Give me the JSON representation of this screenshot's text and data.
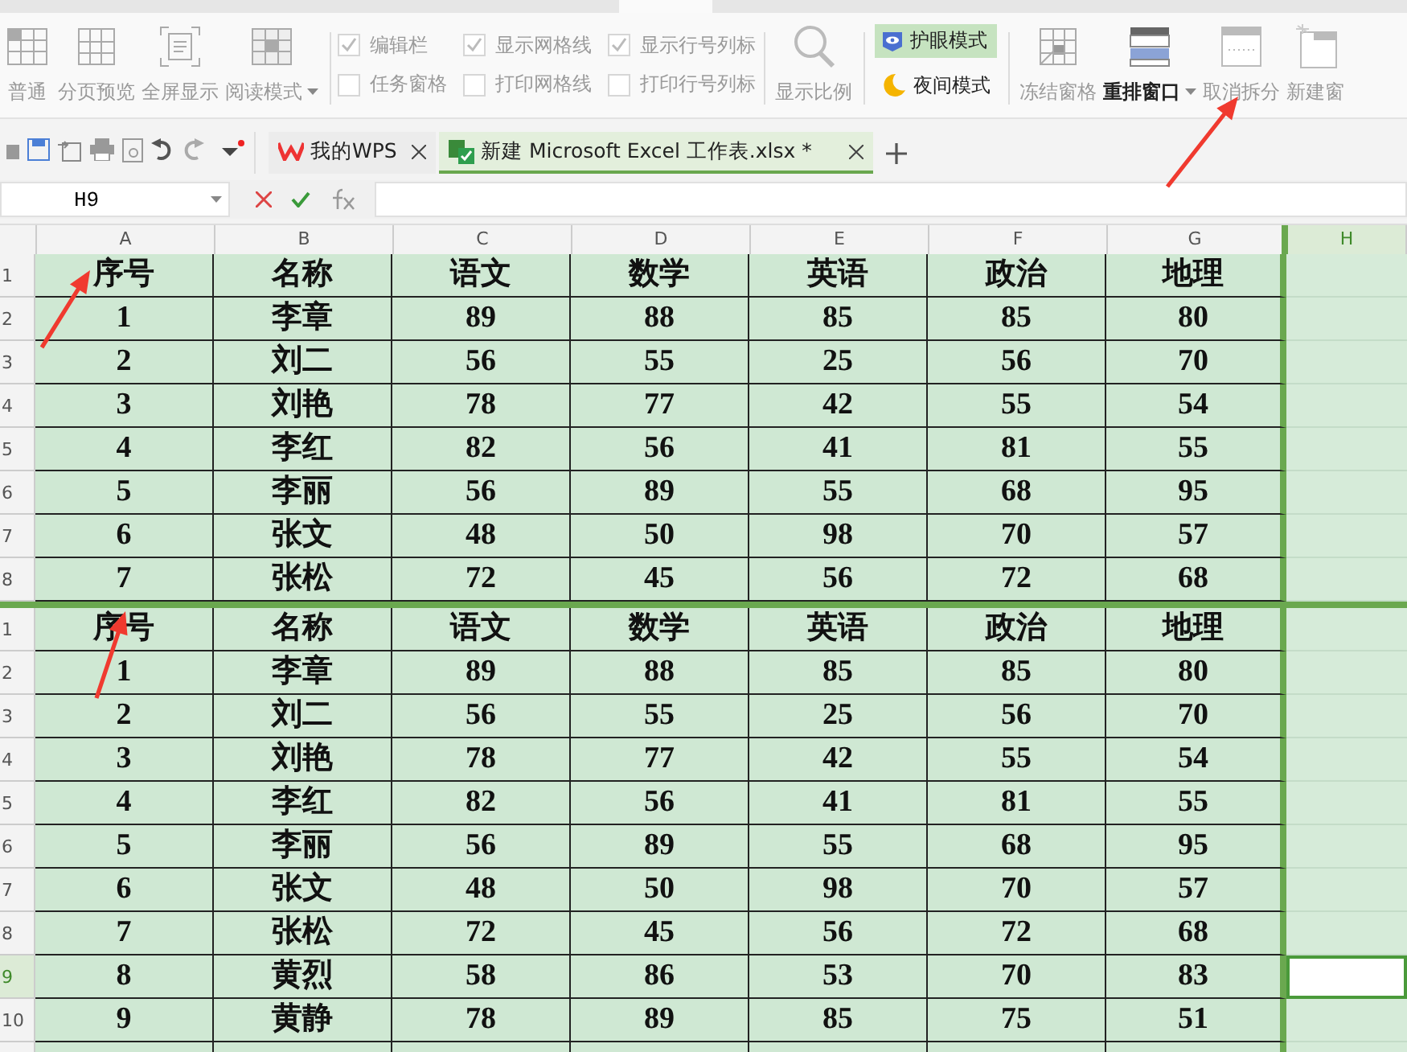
{
  "ribbon": {
    "view_buttons": [
      {
        "kind": "normal",
        "label": "普通",
        "disabled": true,
        "dropdown": false
      },
      {
        "kind": "page-preview",
        "label": "分页预览",
        "disabled": true,
        "dropdown": false
      },
      {
        "kind": "fullscreen",
        "label": "全屏显示",
        "disabled": true,
        "dropdown": false
      },
      {
        "kind": "reading",
        "label": "阅读模式",
        "disabled": true,
        "dropdown": true
      }
    ],
    "checkboxes": [
      {
        "label": "编辑栏",
        "checked": true
      },
      {
        "label": "任务窗格",
        "checked": false
      },
      {
        "label": "显示网格线",
        "checked": true
      },
      {
        "label": "打印网格线",
        "checked": false
      },
      {
        "label": "显示行号列标",
        "checked": true
      },
      {
        "label": "打印行号列标",
        "checked": false
      }
    ],
    "zoom_button": {
      "label": "显示比例",
      "disabled": true
    },
    "modes": [
      {
        "kind": "eye",
        "label": "护眼模式",
        "selected": true
      },
      {
        "kind": "night",
        "label": "夜间模式",
        "selected": false
      }
    ],
    "window_buttons": [
      {
        "kind": "freeze",
        "label": "冻结窗格",
        "disabled": true,
        "dropdown": false
      },
      {
        "kind": "arrange",
        "label": "重排窗口",
        "disabled": false,
        "dropdown": true
      },
      {
        "kind": "unsplit",
        "label": "取消拆分",
        "disabled": true,
        "dropdown": false
      },
      {
        "kind": "new-window",
        "label": "新建窗",
        "disabled": true,
        "dropdown": false
      }
    ]
  },
  "doc_tabs": [
    {
      "kind": "wps",
      "label": "我的WPS",
      "selected": false
    },
    {
      "kind": "excel",
      "label": "新建 Microsoft Excel 工作表.xlsx *",
      "selected": true
    }
  ],
  "formula_bar": {
    "name_box": "H9"
  },
  "columns": [
    {
      "label": "A",
      "selected": false
    },
    {
      "label": "B",
      "selected": false
    },
    {
      "label": "C",
      "selected": false
    },
    {
      "label": "D",
      "selected": false
    },
    {
      "label": "E",
      "selected": false
    },
    {
      "label": "F",
      "selected": false
    },
    {
      "label": "G",
      "selected": false
    },
    {
      "label": "H",
      "selected": true
    }
  ],
  "panes": [
    {
      "rows": [
        {
          "num": "1",
          "selected": false,
          "cells": [
            "序号",
            "名称",
            "语文",
            "数学",
            "英语",
            "政治",
            "地理"
          ]
        },
        {
          "num": "2",
          "selected": false,
          "cells": [
            "1",
            "李章",
            "89",
            "88",
            "85",
            "85",
            "80"
          ]
        },
        {
          "num": "3",
          "selected": false,
          "cells": [
            "2",
            "刘二",
            "56",
            "55",
            "25",
            "56",
            "70"
          ]
        },
        {
          "num": "4",
          "selected": false,
          "cells": [
            "3",
            "刘艳",
            "78",
            "77",
            "42",
            "55",
            "54"
          ]
        },
        {
          "num": "5",
          "selected": false,
          "cells": [
            "4",
            "李红",
            "82",
            "56",
            "41",
            "81",
            "55"
          ]
        },
        {
          "num": "6",
          "selected": false,
          "cells": [
            "5",
            "李丽",
            "56",
            "89",
            "55",
            "68",
            "95"
          ]
        },
        {
          "num": "7",
          "selected": false,
          "cells": [
            "6",
            "张文",
            "48",
            "50",
            "98",
            "70",
            "57"
          ]
        },
        {
          "num": "8",
          "selected": false,
          "cells": [
            "7",
            "张松",
            "72",
            "45",
            "56",
            "72",
            "68"
          ]
        }
      ]
    },
    {
      "rows": [
        {
          "num": "1",
          "selected": false,
          "cells": [
            "序号",
            "名称",
            "语文",
            "数学",
            "英语",
            "政治",
            "地理"
          ]
        },
        {
          "num": "2",
          "selected": false,
          "cells": [
            "1",
            "李章",
            "89",
            "88",
            "85",
            "85",
            "80"
          ]
        },
        {
          "num": "3",
          "selected": false,
          "cells": [
            "2",
            "刘二",
            "56",
            "55",
            "25",
            "56",
            "70"
          ]
        },
        {
          "num": "4",
          "selected": false,
          "cells": [
            "3",
            "刘艳",
            "78",
            "77",
            "42",
            "55",
            "54"
          ]
        },
        {
          "num": "5",
          "selected": false,
          "cells": [
            "4",
            "李红",
            "82",
            "56",
            "41",
            "81",
            "55"
          ]
        },
        {
          "num": "6",
          "selected": false,
          "cells": [
            "5",
            "李丽",
            "56",
            "89",
            "55",
            "68",
            "95"
          ]
        },
        {
          "num": "7",
          "selected": false,
          "cells": [
            "6",
            "张文",
            "48",
            "50",
            "98",
            "70",
            "57"
          ]
        },
        {
          "num": "8",
          "selected": false,
          "cells": [
            "7",
            "张松",
            "72",
            "45",
            "56",
            "72",
            "68"
          ]
        },
        {
          "num": "9",
          "selected": true,
          "cells": [
            "8",
            "黄烈",
            "58",
            "86",
            "53",
            "70",
            "83"
          ]
        },
        {
          "num": "10",
          "selected": false,
          "cells": [
            "9",
            "黄静",
            "78",
            "89",
            "85",
            "75",
            "51"
          ]
        }
      ]
    }
  ]
}
